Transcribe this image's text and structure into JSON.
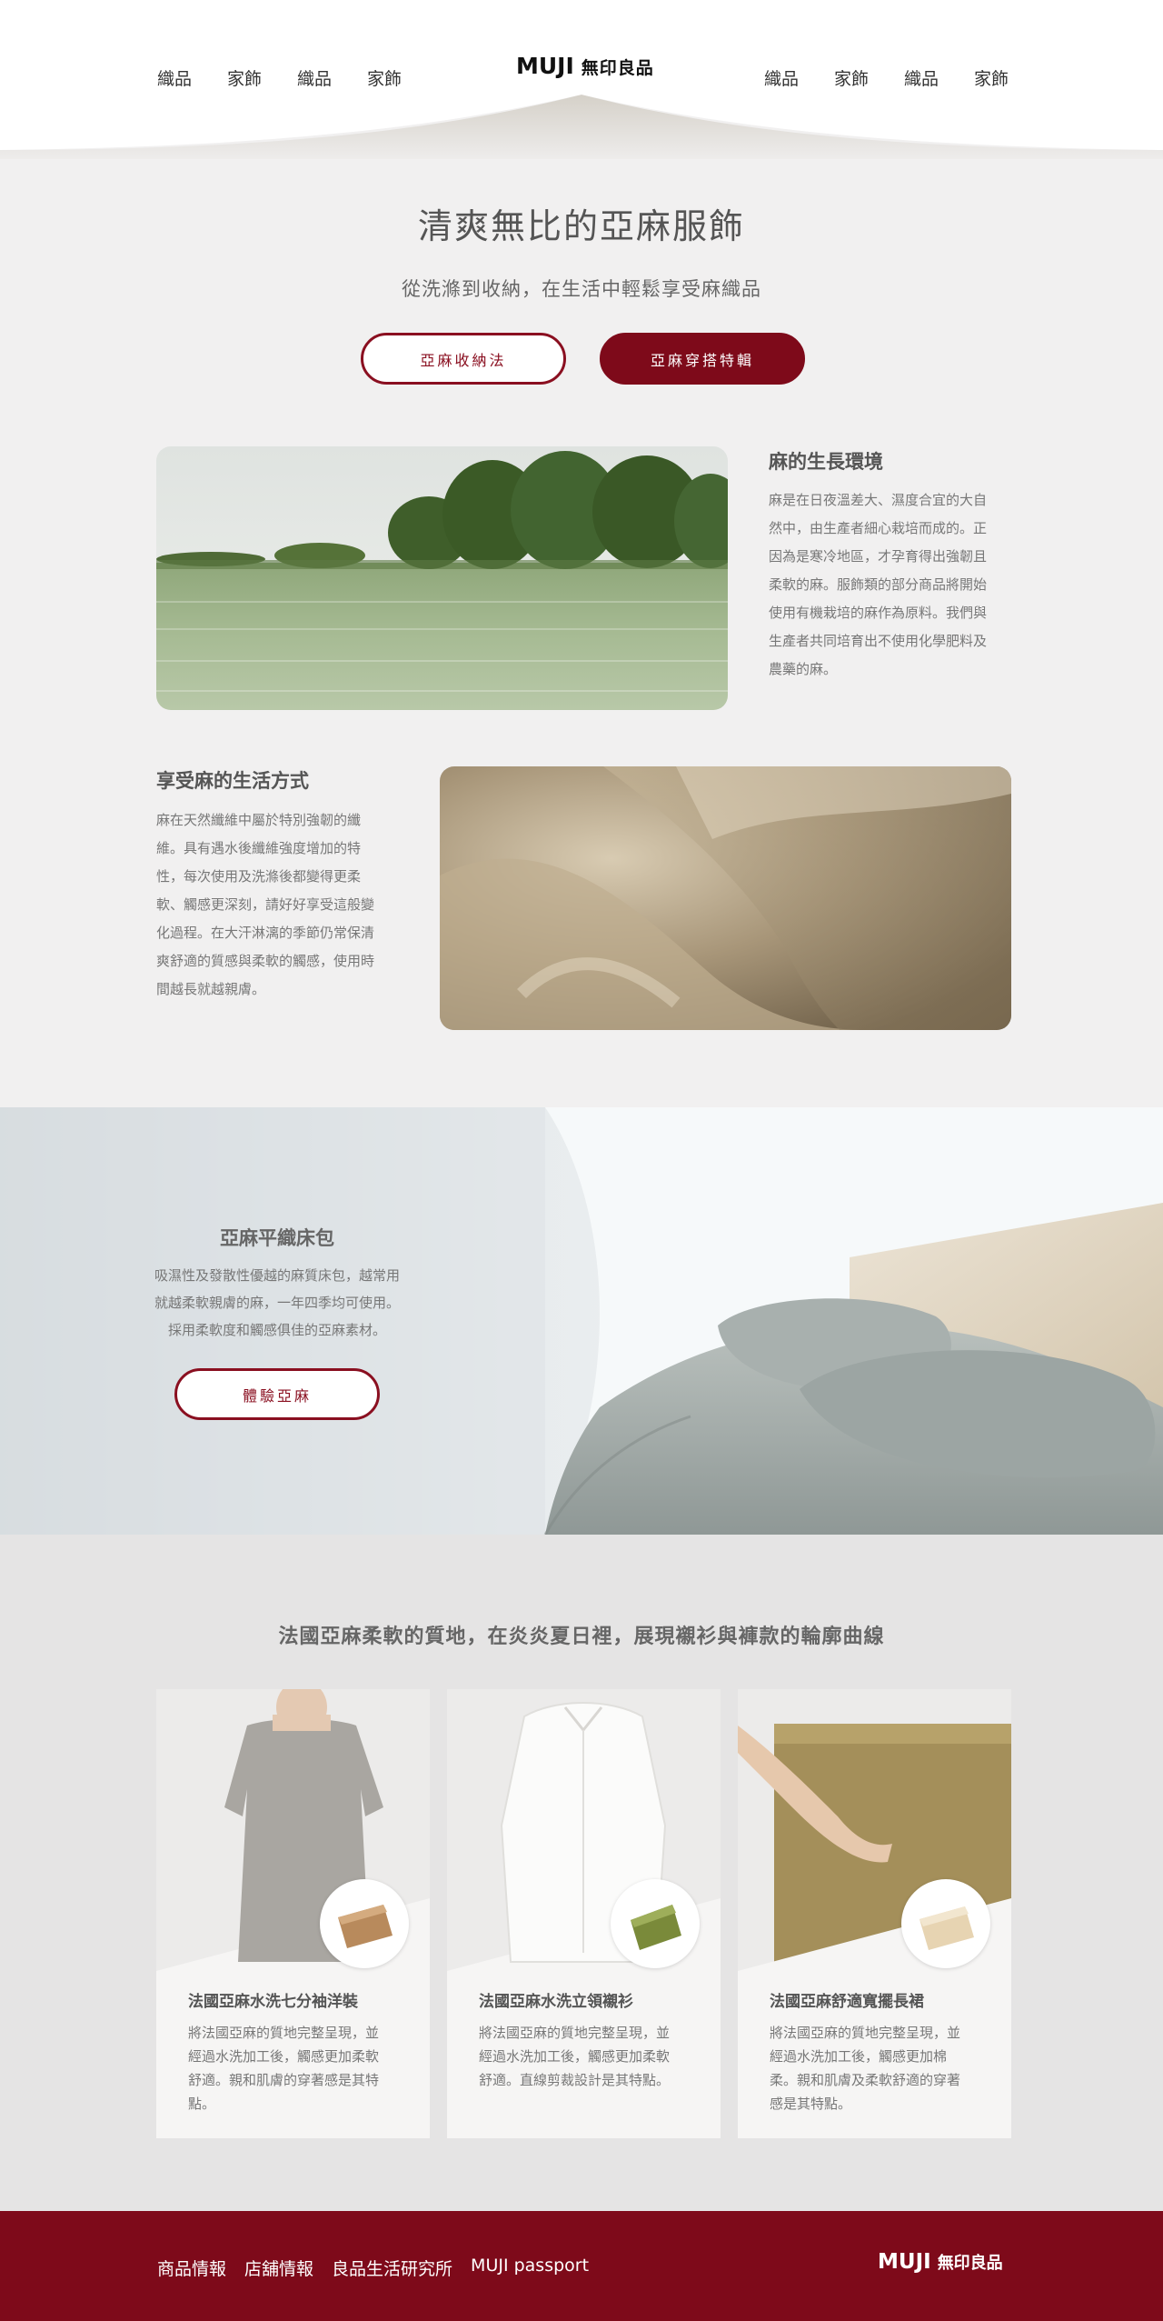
{
  "header": {
    "nav_left": [
      "織品",
      "家飾",
      "織品",
      "家飾"
    ],
    "nav_right": [
      "織品",
      "家飾",
      "織品",
      "家飾"
    ],
    "logo_latin": "MUJI",
    "logo_cn": "無印良品"
  },
  "hero": {
    "title": "清爽無比的亞麻服飾",
    "subtitle": "從洗滌到收納，在生活中輕鬆享受麻織品",
    "button_storage": "亞麻收納法",
    "button_styling": "亞麻穿搭特輯"
  },
  "features": [
    {
      "title": "麻的生長環境",
      "lines": [
        "麻是在日夜溫差大、濕度合宜的大自",
        "然中，由生產者細心栽培而成的。正",
        "因為是寒冷地區，才孕育得出強韌且",
        "柔軟的麻。服飾類的部分商品將開始",
        "使用有機栽培的麻作為原料。我們與",
        "生產者共同培育出不使用化學肥料及",
        "農藥的麻。"
      ]
    },
    {
      "title": "享受麻的生活方式",
      "lines": [
        "麻在天然纖維中屬於特別強韌的纖",
        "維。具有遇水後纖維強度增加的特",
        "性，每次使用及洗滌後都變得更柔",
        "軟、觸感更深刻，請好好享受這般變",
        "化過程。在大汗淋漓的季節仍常保清",
        "爽舒適的質感與柔軟的觸感，使用時",
        "間越長就越親膚。"
      ]
    }
  ],
  "bedding": {
    "title": "亞麻平織床包",
    "lines": [
      "吸濕性及發散性優越的麻質床包，越常用",
      "就越柔軟親膚的麻，一年四季均可使用。",
      "採用柔軟度和觸感俱佳的亞麻素材。"
    ],
    "button": "體驗亞麻"
  },
  "products": {
    "title": "法國亞麻柔軟的質地，在炎炎夏日裡，展現襯衫與褲款的輪廓曲線",
    "items": [
      {
        "name": "法國亞麻水洗七分袖洋裝",
        "lines": [
          "將法國亞麻的質地完整呈現，並",
          "經過水洗加工後，觸感更加柔軟",
          "舒適。親和肌膚的穿著感是其特",
          "點。"
        ]
      },
      {
        "name": "法國亞麻水洗立領襯衫",
        "lines": [
          "將法國亞麻的質地完整呈現，並",
          "經過水洗加工後，觸感更加柔軟",
          "舒適。直線剪裁設計是其特點。"
        ]
      },
      {
        "name": "法國亞麻舒適寬擺長裙",
        "lines": [
          "將法國亞麻的質地完整呈現，並",
          "經過水洗加工後，觸感更加棉",
          "柔。親和肌膚及柔軟舒適的穿著",
          "感是其特點。"
        ]
      }
    ]
  },
  "footer": {
    "links": [
      "商品情報",
      "店舖情報",
      "良品生活研究所",
      "MUJI passport"
    ],
    "logo_latin": "MUJI",
    "logo_cn": "無印良品"
  },
  "colors": {
    "brand": "#7e0a1a",
    "background": "#f1f0f0"
  }
}
